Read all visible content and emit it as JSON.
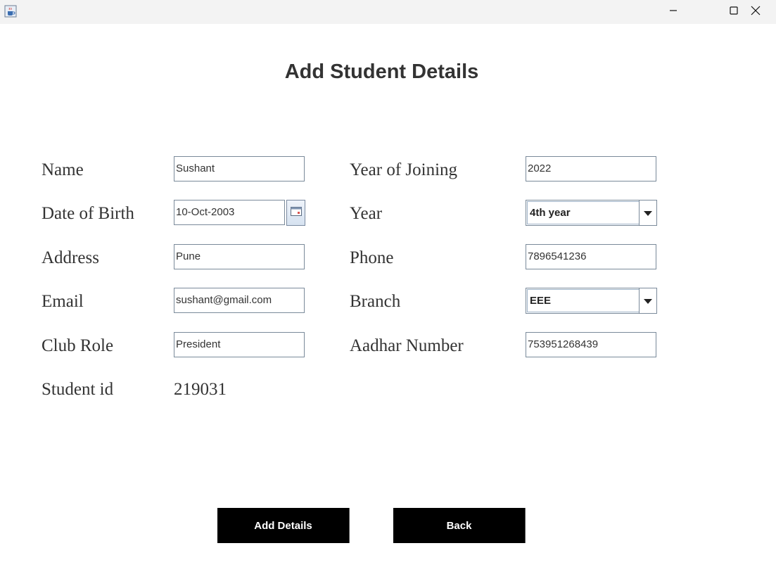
{
  "window": {
    "app_icon": "java-coffee-icon",
    "controls": [
      "minimize-icon",
      "maximize-icon",
      "close-icon"
    ]
  },
  "page_title": "Add Student Details",
  "left_fields": {
    "name_label": "Name",
    "name_value": "Sushant",
    "dob_label": "Date of Birth",
    "dob_value": "10-Oct-2003",
    "address_label": "Address",
    "address_value": "Pune",
    "email_label": "Email",
    "email_value": "sushant@gmail.com",
    "club_role_label": "Club Role",
    "club_role_value": "President",
    "student_id_label": "Student id",
    "student_id_value": "219031"
  },
  "right_fields": {
    "year_of_joining_label": "Year of Joining",
    "year_of_joining_value": "2022",
    "year_label": "Year",
    "year_selected": "4th year",
    "phone_label": "Phone",
    "phone_value": "7896541236",
    "branch_label": "Branch",
    "branch_selected": "EEE",
    "aadhar_label": "Aadhar Number",
    "aadhar_value": "753951268439"
  },
  "buttons": {
    "add_label": "Add Details",
    "back_label": "Back"
  },
  "colors": {
    "button_bg": "#000000",
    "button_text": "#ffffff",
    "label_text": "#333333",
    "field_border": "#7a8a9a"
  }
}
